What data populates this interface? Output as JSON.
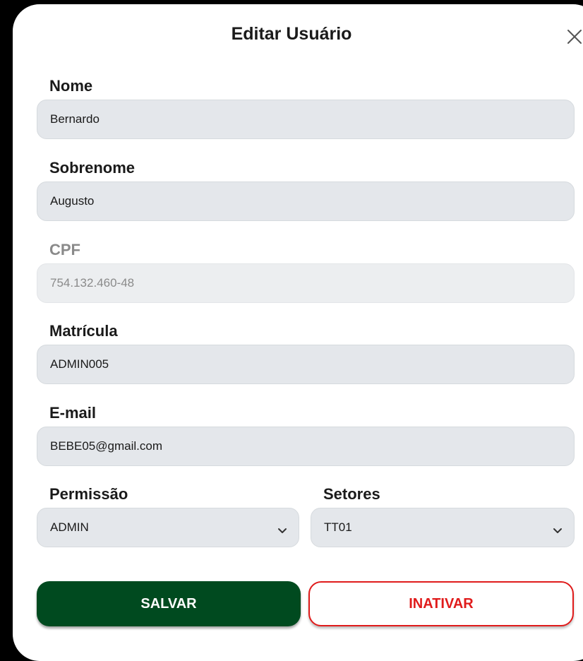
{
  "modal": {
    "title": "Editar Usuário",
    "close_icon": "close-icon"
  },
  "fields": {
    "nome": {
      "label": "Nome",
      "value": "Bernardo"
    },
    "sobrenome": {
      "label": "Sobrenome",
      "value": "Augusto"
    },
    "cpf": {
      "label": "CPF",
      "value": "754.132.460-48",
      "disabled": true
    },
    "matricula": {
      "label": "Matrícula",
      "value": "ADMIN005"
    },
    "email": {
      "label": "E-mail",
      "value": "BEBE05@gmail.com"
    },
    "permissao": {
      "label": "Permissão",
      "selected": "ADMIN"
    },
    "setores": {
      "label": "Setores",
      "selected": "TT01"
    }
  },
  "actions": {
    "save_label": "SALVAR",
    "inactivate_label": "INATIVAR"
  },
  "colors": {
    "primary": "#004a1f",
    "danger": "#e01b1b",
    "field_bg": "#e4e7eb",
    "backdrop": "#000000"
  }
}
